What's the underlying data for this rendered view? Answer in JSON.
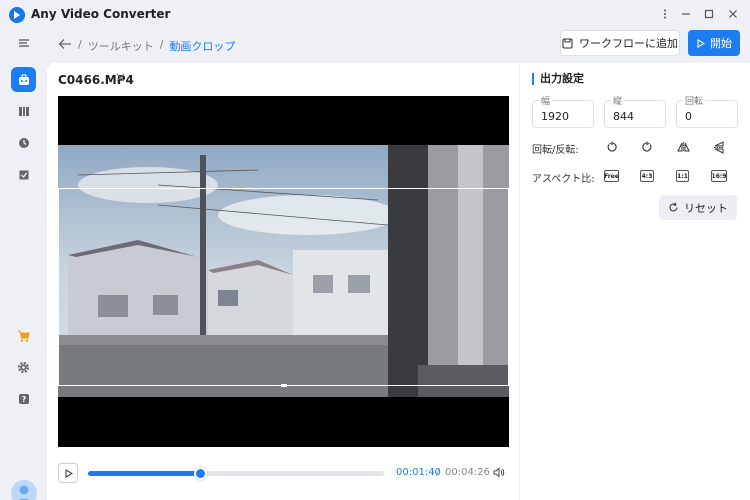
{
  "app": {
    "title": "Any Video Converter"
  },
  "header": {
    "breadcrumb": [
      "ツールキット",
      "動画クロップ"
    ],
    "separator": "/",
    "workflow_label": "ワークフローに追加",
    "start_label": "開始"
  },
  "file": {
    "name": "C0466.MP4"
  },
  "player": {
    "current_time": "00:01:40",
    "separator": "/",
    "total_time": "00:04:26",
    "progress": 0.38
  },
  "output": {
    "title": "出力設定",
    "width_label": "幅",
    "width_value": "1920",
    "height_label": "縦",
    "height_value": "844",
    "rotate_label": "回転",
    "rotate_value": "0",
    "rotate_flip_label": "回転/反転:",
    "aspect_label": "アスペクト比:",
    "aspect_options": [
      "Free",
      "4:3",
      "1:1",
      "16:9"
    ],
    "reset_label": "リセット"
  },
  "colors": {
    "accent": "#1c7cf2",
    "background": "#eef0f6"
  }
}
